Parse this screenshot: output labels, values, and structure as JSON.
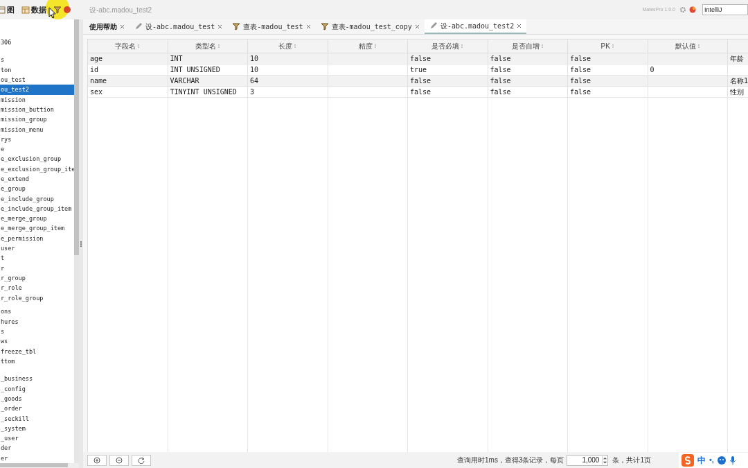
{
  "toolbar": {
    "items": [
      {
        "label": "图",
        "kind": "chart"
      },
      {
        "label": "数据",
        "kind": "data"
      },
      {
        "kind": "query",
        "highlighted": true
      }
    ],
    "title": "设-abc.madou_test2",
    "version": "MatesPro 1.0.0",
    "theme_field": {
      "value": "IntelliJ"
    }
  },
  "sidebar": {
    "groups": [
      [
        {
          "text": "306",
          "selected": false
        }
      ],
      [
        {
          "text": "s",
          "selected": false
        },
        {
          "text": "ton",
          "selected": false
        },
        {
          "text": "ou_test",
          "selected": false
        },
        {
          "text": "ou_test2",
          "selected": true
        },
        {
          "text": "mission",
          "selected": false
        },
        {
          "text": "mission_buttion",
          "selected": false
        },
        {
          "text": "mission_group",
          "selected": false
        },
        {
          "text": "mission_menu",
          "selected": false
        },
        {
          "text": "rys",
          "selected": false
        },
        {
          "text": "e",
          "selected": false
        },
        {
          "text": "e_exclusion_group",
          "selected": false
        },
        {
          "text": "e_exclusion_group_ite",
          "selected": false
        },
        {
          "text": "e_extend",
          "selected": false
        },
        {
          "text": "e_group",
          "selected": false
        },
        {
          "text": "e_include_group",
          "selected": false
        },
        {
          "text": "e_include_group_item",
          "selected": false
        },
        {
          "text": "e_merge_group",
          "selected": false
        },
        {
          "text": "e_merge_group_item",
          "selected": false
        },
        {
          "text": "e_permission",
          "selected": false
        },
        {
          "text": "user",
          "selected": false
        },
        {
          "text": "t",
          "selected": false
        },
        {
          "text": "r",
          "selected": false
        },
        {
          "text": "r_group",
          "selected": false
        },
        {
          "text": "r_role",
          "selected": false
        },
        {
          "text": "r_role_group",
          "selected": false
        }
      ],
      [
        {
          "text": "ons",
          "selected": false
        },
        {
          "text": "hures",
          "selected": false
        },
        {
          "text": "s",
          "selected": false
        },
        {
          "text": "ws",
          "selected": false
        },
        {
          "text": "freeze_tbl",
          "selected": false
        },
        {
          "text": "ttom",
          "selected": false
        }
      ],
      [
        {
          "text": "_business",
          "selected": false
        },
        {
          "text": "_config",
          "selected": false
        },
        {
          "text": "_goods",
          "selected": false
        },
        {
          "text": "_order",
          "selected": false
        },
        {
          "text": "_seckill",
          "selected": false
        },
        {
          "text": "_system",
          "selected": false
        },
        {
          "text": "_user",
          "selected": false
        },
        {
          "text": "der",
          "selected": false
        },
        {
          "text": "er",
          "selected": false
        }
      ]
    ]
  },
  "tabs": [
    {
      "label": "使用帮助",
      "kind": "help",
      "selected": false
    },
    {
      "label": "设-abc.madou_test",
      "kind": "design",
      "selected": false
    },
    {
      "label": "查表-madou_test",
      "kind": "query",
      "selected": false
    },
    {
      "label": "查表-madou_test_copy",
      "kind": "query",
      "selected": false
    },
    {
      "label": "设-abc.madou_test2",
      "kind": "design",
      "selected": true
    }
  ],
  "table": {
    "columns": [
      "字段名",
      "类型名",
      "长度",
      "精度",
      "是否必填",
      "是否自增",
      "PK",
      "默认值",
      ""
    ],
    "rows": [
      [
        "age",
        "INT",
        "10",
        "",
        "false",
        "false",
        "false",
        "",
        "年龄"
      ],
      [
        "id",
        "INT UNSIGNED",
        "10",
        "",
        "true",
        "false",
        "false",
        "0",
        ""
      ],
      [
        "name",
        "VARCHAR",
        "64",
        "",
        "false",
        "false",
        "false",
        "",
        "名称1"
      ],
      [
        "sex",
        "TINYINT UNSIGNED",
        "3",
        "",
        "false",
        "false",
        "false",
        "",
        "性别"
      ]
    ]
  },
  "status_bar": {
    "summary": "查询用时1ms，查得3条记录，每页",
    "page_size": "1,000",
    "pages": "条，共计1页"
  },
  "ime_bar": {
    "mode": "中",
    "punct": "•,"
  }
}
